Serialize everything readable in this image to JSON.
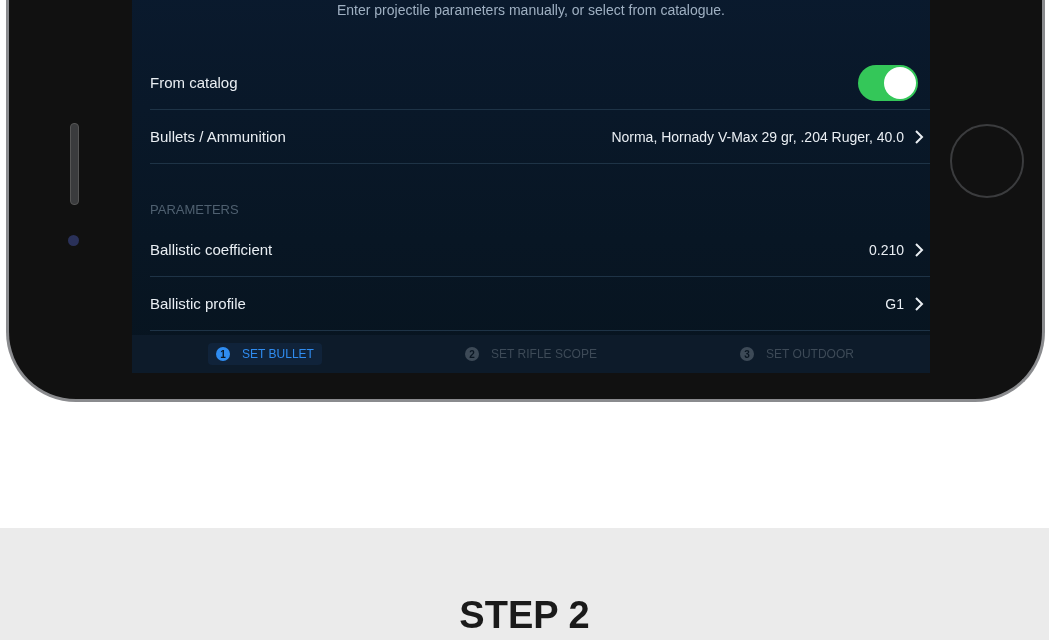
{
  "screen": {
    "subtitle": "Enter projectile parameters manually, or select from catalogue.",
    "rows": [
      {
        "kind": "toggle",
        "label": "From catalog",
        "on": true
      },
      {
        "kind": "link",
        "label": "Bullets / Ammunition",
        "value": "Norma, Hornady V-Max 29 gr, .204 Ruger, 40.0"
      }
    ],
    "section": "PARAMETERS",
    "parameters": [
      {
        "kind": "link",
        "label": "Ballistic coefficient",
        "value": "0.210"
      },
      {
        "kind": "link",
        "label": "Ballistic profile",
        "value": "G1"
      }
    ],
    "steps": [
      {
        "number": "1",
        "label": "SET BULLET",
        "selected": true
      },
      {
        "number": "2",
        "label": "SET RIFLE SCOPE",
        "selected": false
      },
      {
        "number": "3",
        "label": "SET OUTDOOR",
        "selected": false
      }
    ]
  },
  "heading": "STEP 2"
}
